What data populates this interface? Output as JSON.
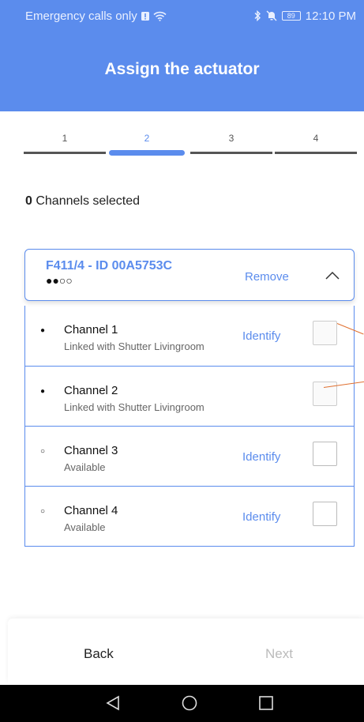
{
  "status_bar": {
    "carrier_text": "Emergency calls only",
    "battery_level": "89",
    "time": "12:10 PM",
    "icons": [
      "sim-alert-icon",
      "wifi-icon",
      "bluetooth-icon",
      "mute-icon",
      "battery-icon"
    ]
  },
  "header": {
    "title": "Assign the actuator"
  },
  "stepper": {
    "steps": [
      {
        "label": "1",
        "active": false
      },
      {
        "label": "2",
        "active": true
      },
      {
        "label": "3",
        "active": false
      },
      {
        "label": "4",
        "active": false
      }
    ]
  },
  "selection": {
    "count": "0",
    "label": " Channels selected"
  },
  "device": {
    "title": "F411/4 - ID 00A5753C",
    "status_dots": "●●○○",
    "remove_label": "Remove",
    "expanded": true
  },
  "channels": [
    {
      "dot": "●",
      "name": "Channel 1",
      "status": "Linked with Shutter Livingroom",
      "identify_label": "Identify",
      "checked": false,
      "has_identify": true
    },
    {
      "dot": "●",
      "name": "Channel 2",
      "status": "Linked with Shutter Livingroom",
      "identify_label": "",
      "checked": false,
      "has_identify": false
    },
    {
      "dot": "○",
      "name": "Channel 3",
      "status": "Available",
      "identify_label": "Identify",
      "checked": false,
      "has_identify": true
    },
    {
      "dot": "○",
      "name": "Channel 4",
      "status": "Available",
      "identify_label": "Identify",
      "checked": false,
      "has_identify": true
    }
  ],
  "footer": {
    "back_label": "Back",
    "next_label": "Next"
  },
  "navbar": {
    "icons": [
      "back-triangle-icon",
      "home-circle-icon",
      "recents-square-icon"
    ]
  },
  "colors": {
    "accent": "#5b8ced",
    "annotation": "#e07030",
    "navbar": "#000000"
  }
}
